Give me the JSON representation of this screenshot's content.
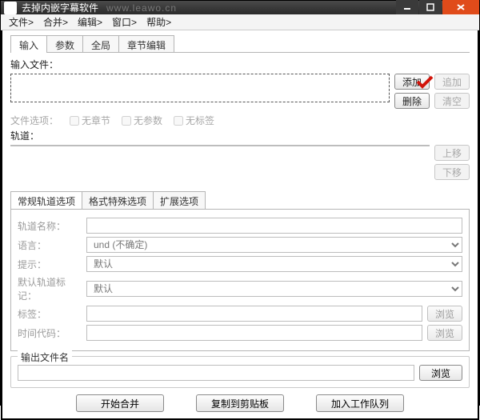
{
  "window": {
    "title": "去掉内嵌字幕软件",
    "url": "www.leawo.cn"
  },
  "menubar": {
    "file": "文件>",
    "merge": "合并>",
    "edit": "编辑>",
    "window": "窗口>",
    "help": "帮助>"
  },
  "tabs": {
    "input": "输入",
    "params": "参数",
    "global": "全局",
    "chapter": "章节编辑"
  },
  "labels": {
    "input_file": "输入文件：",
    "file_options": "文件选项：",
    "no_chapter": "无章节",
    "no_params": "无参数",
    "no_tags": "无标签",
    "tracks": "轨道：",
    "output_group": "输出文件名"
  },
  "buttons": {
    "add": "添加",
    "append": "追加",
    "delete": "删除",
    "clear": "清空",
    "move_up": "上移",
    "move_down": "下移",
    "browse": "浏览",
    "browse2": "浏览",
    "out_browse": "浏览",
    "start_merge": "开始合并",
    "copy_clip": "复制到剪贴板",
    "add_queue": "加入工作队列"
  },
  "subtabs": {
    "general": "常规轨道选项",
    "special": "格式特殊选项",
    "ext": "扩展选项"
  },
  "form": {
    "track_name": {
      "label": "轨道名称：",
      "value": ""
    },
    "language": {
      "label": "语言：",
      "value": "und (不确定)"
    },
    "hint": {
      "label": "提示：",
      "value": "默认"
    },
    "default_flag": {
      "label": "默认轨道标记：",
      "value": "默认"
    },
    "tags": {
      "label": "标签：",
      "value": ""
    },
    "timecode": {
      "label": "时间代码：",
      "value": ""
    }
  },
  "output": {
    "value": ""
  }
}
